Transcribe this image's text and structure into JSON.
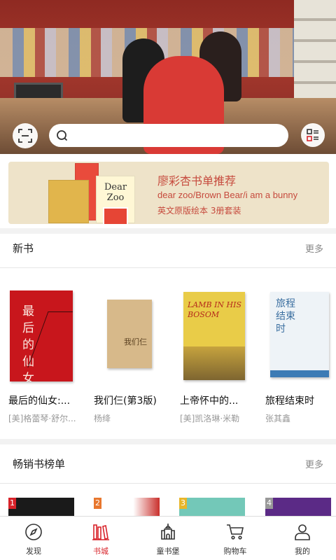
{
  "search": {
    "placeholder": ""
  },
  "banner": {
    "title": "廖彩杏书单推荐",
    "line1": "dear zoo/Brown Bear/i am a bunny",
    "line2": "英文原版绘本 3册套装",
    "cover_text": "Dear Zoo"
  },
  "new_books": {
    "title": "新书",
    "more": "更多",
    "items": [
      {
        "title": "最后的仙女:...",
        "author": "[美]格蕾琴·舒尔...",
        "cover_text": "最后的仙女"
      },
      {
        "title": "我们仨(第3版)",
        "author": "杨绛",
        "cover_text": "我们仨"
      },
      {
        "title": "上帝怀中的...",
        "author": "[美]凯洛琳·米勒",
        "cover_text": "LAMB IN HIS BOSOM"
      },
      {
        "title": "旅程结束时",
        "author": "张其鑫",
        "cover_text": "旅程结束时"
      }
    ]
  },
  "bestsellers": {
    "title": "畅销书榜单",
    "more": "更多",
    "ranks": [
      "1",
      "2",
      "3",
      "4"
    ]
  },
  "tabbar": {
    "items": [
      {
        "label": "发现",
        "icon": "compass-icon"
      },
      {
        "label": "书城",
        "icon": "bookshelf-icon"
      },
      {
        "label": "童书堡",
        "icon": "castle-icon"
      },
      {
        "label": "购物车",
        "icon": "cart-icon"
      },
      {
        "label": "我的",
        "icon": "user-icon"
      }
    ],
    "active_index": 1,
    "active_color": "#d8232a"
  },
  "colors": {
    "accent": "#d8232a",
    "banner_bg": "#eee3c9",
    "banner_text": "#c64a3d"
  }
}
